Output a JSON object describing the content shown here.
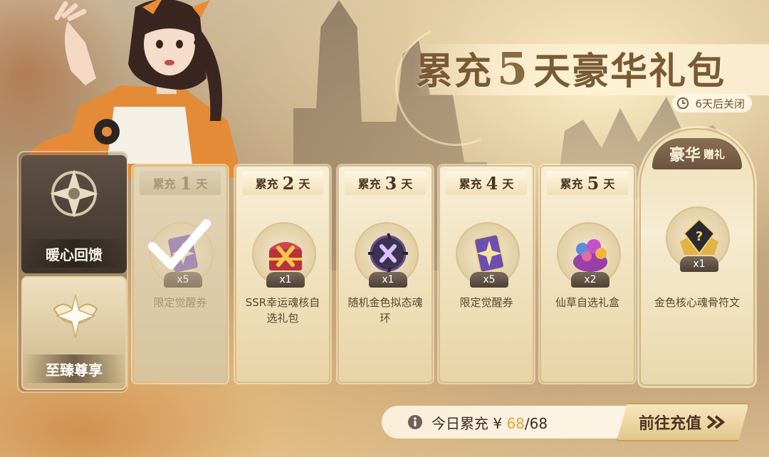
{
  "title": {
    "prefix": "累充",
    "number": "5",
    "suffix": "天豪华礼包"
  },
  "countdown": "6天后关闭",
  "sidebar": [
    {
      "label": "暖心回馈",
      "active": true
    },
    {
      "label": "至臻尊享",
      "active": false
    }
  ],
  "days": [
    {
      "prefix": "累充",
      "num": "1",
      "suffix": "天",
      "item": "限定觉醒券",
      "qty": "x5",
      "claimed": true
    },
    {
      "prefix": "累充",
      "num": "2",
      "suffix": "天",
      "item": "SSR幸运魂核自选礼包",
      "qty": "x1",
      "claimed": false
    },
    {
      "prefix": "累充",
      "num": "3",
      "suffix": "天",
      "item": "随机金色拟态魂环",
      "qty": "x1",
      "claimed": false
    },
    {
      "prefix": "累充",
      "num": "4",
      "suffix": "天",
      "item": "限定觉醒券",
      "qty": "x5",
      "claimed": false
    },
    {
      "prefix": "累充",
      "num": "5",
      "suffix": "天",
      "item": "仙草自选礼盒",
      "qty": "x2",
      "claimed": false
    }
  ],
  "luxury": {
    "big": "豪华",
    "small": "赠礼",
    "item": "金色核心魂骨符文",
    "qty": "x1"
  },
  "recharge": {
    "label": "今日累充",
    "currency": "¥",
    "current": "68",
    "sep": "/",
    "target": "68"
  },
  "goto_button": "前往充值",
  "colors": {
    "accent": "#e3a53c",
    "gold": "#d9bf88",
    "dark": "#4b3522"
  }
}
